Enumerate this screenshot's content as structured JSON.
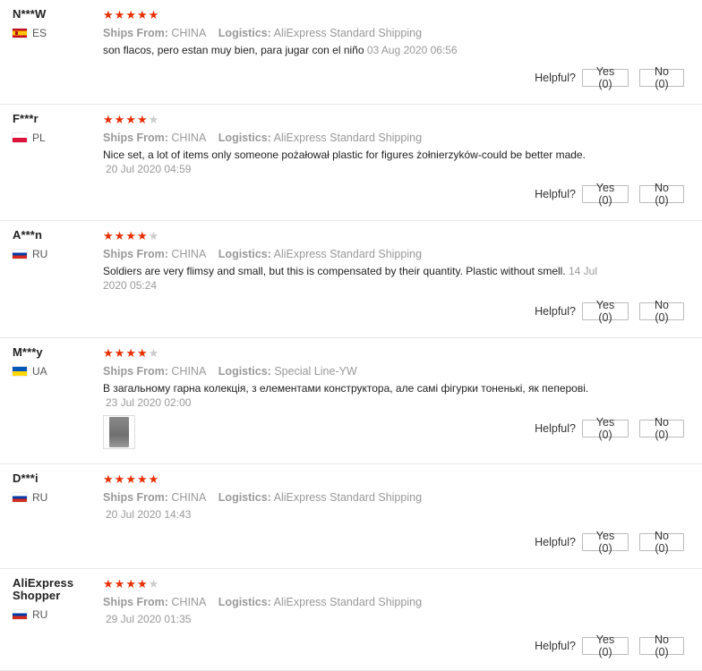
{
  "labels": {
    "ships_from": "Ships From:",
    "logistics": "Logistics:",
    "helpful": "Helpful?"
  },
  "colors": {
    "star_on": "#e62e04",
    "star_off": "#cccccc"
  },
  "reviews": [
    {
      "user": "N***W",
      "country": "ES",
      "flag": "es",
      "stars": 5,
      "ships_from": "CHINA",
      "logistics": "AliExpress Standard Shipping",
      "text": "son flacos, pero estan muy bien, para jugar con el niño",
      "date": "03 Aug 2020 06:56",
      "yes": "Yes (0)",
      "no": "No (0)"
    },
    {
      "user": "F***r",
      "country": "PL",
      "flag": "pl",
      "stars": 4,
      "ships_from": "CHINA",
      "logistics": "AliExpress Standard Shipping",
      "text": "Nice set, a lot of items only someone pożałował plastic for figures żołnierzyków-could be better made.",
      "date": "20 Jul 2020 04:59",
      "yes": "Yes (0)",
      "no": "No (0)"
    },
    {
      "user": "A***n",
      "country": "RU",
      "flag": "ru",
      "stars": 4,
      "ships_from": "CHINA",
      "logistics": "AliExpress Standard Shipping",
      "text": "Soldiers are very flimsy and small, but this is compensated by their quantity. Plastic without smell.",
      "date": "14 Jul 2020 05:24",
      "yes": "Yes (0)",
      "no": "No (0)"
    },
    {
      "user": "M***y",
      "country": "UA",
      "flag": "ua",
      "stars": 4,
      "ships_from": "CHINA",
      "logistics": "Special Line-YW",
      "text": "В загальному гарна колекція, з елементами конструктора, але самі фігурки тоненькі, як пеперові.",
      "date": "23 Jul 2020 02:00",
      "yes": "Yes (0)",
      "no": "No (0)"
    },
    {
      "user": "D***i",
      "country": "RU",
      "flag": "ru",
      "stars": 5,
      "ships_from": "CHINA",
      "logistics": "AliExpress Standard Shipping",
      "text": "",
      "date": "20 Jul 2020 14:43",
      "yes": "Yes (0)",
      "no": "No (0)"
    },
    {
      "user": "AliExpress Shopper",
      "country": "RU",
      "flag": "ru",
      "stars": 4,
      "ships_from": "CHINA",
      "logistics": "AliExpress Standard Shipping",
      "text": "",
      "date": "29 Jul 2020 01:35",
      "yes": "Yes (0)",
      "no": "No (0)"
    }
  ]
}
